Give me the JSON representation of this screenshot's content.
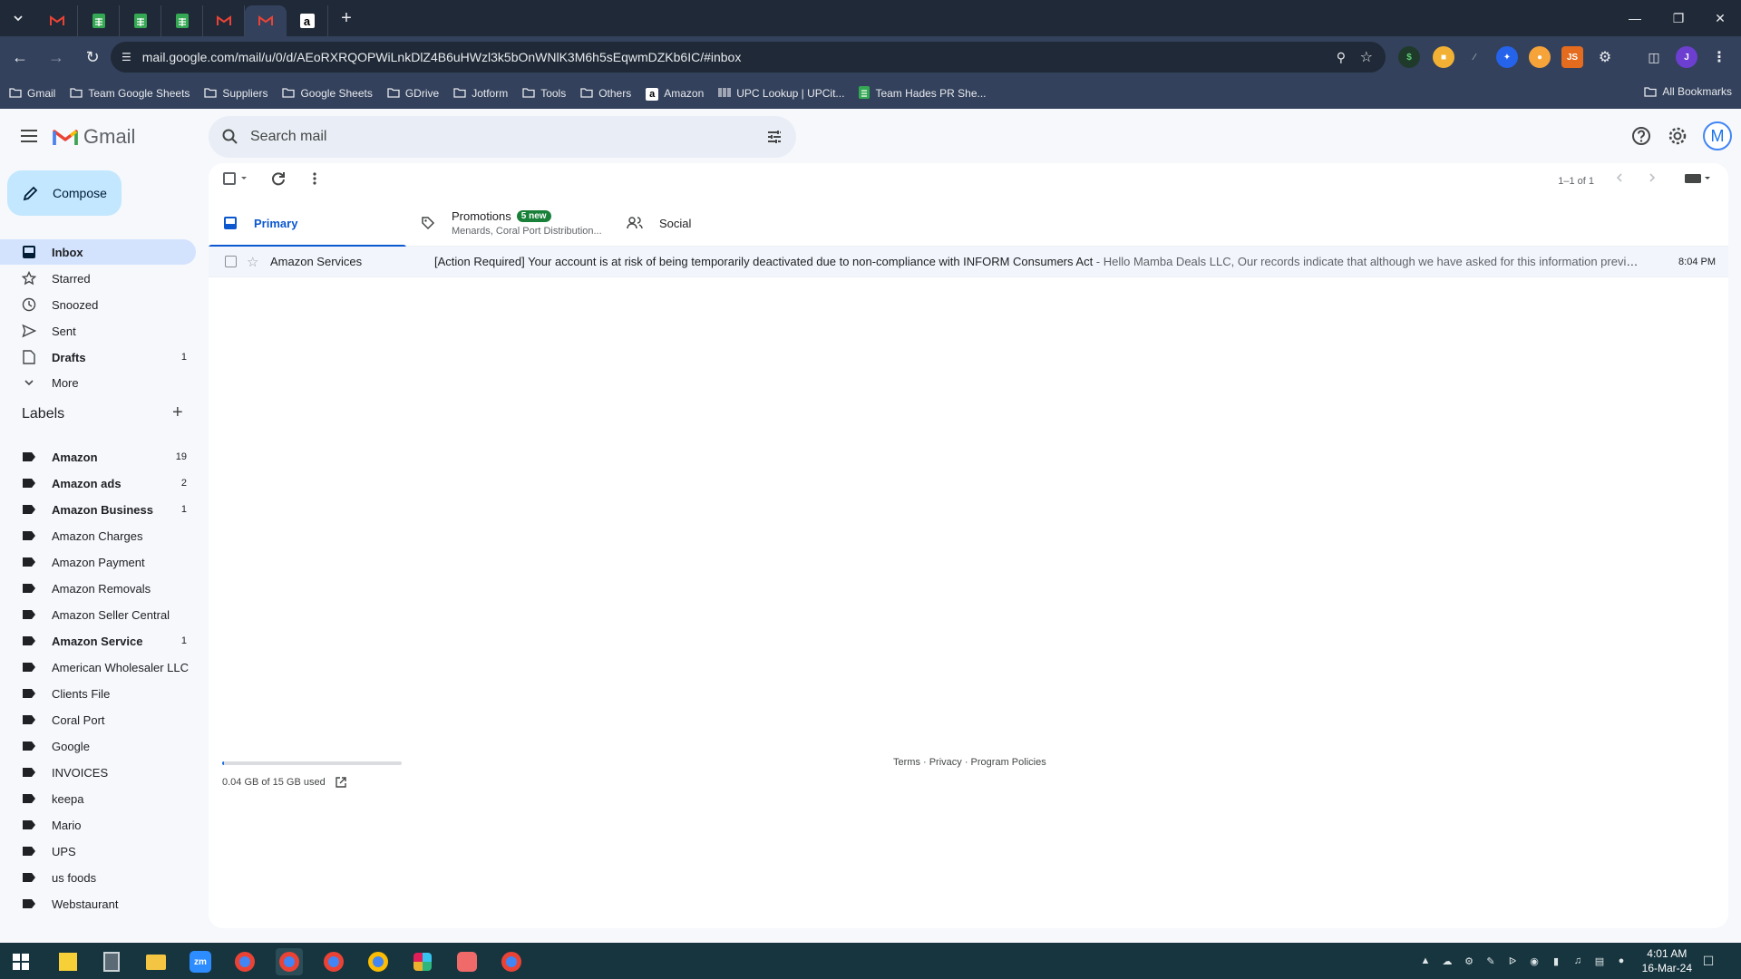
{
  "browser": {
    "address_url": "mail.google.com/mail/u/0/d/AEoRXRQOPWiLnkDlZ4B6uHWzl3k5bOnWNlK3M6h5sEqwmDZKb6IC/#inbox",
    "bookmarks": [
      {
        "label": "Gmail",
        "icon": "folder-icon"
      },
      {
        "label": "Team Google Sheets",
        "icon": "folder-icon"
      },
      {
        "label": "Suppliers",
        "icon": "folder-icon"
      },
      {
        "label": "Google Sheets",
        "icon": "folder-icon"
      },
      {
        "label": "GDrive",
        "icon": "folder-icon"
      },
      {
        "label": "Jotform",
        "icon": "folder-icon"
      },
      {
        "label": "Tools",
        "icon": "folder-icon"
      },
      {
        "label": "Others",
        "icon": "folder-icon"
      },
      {
        "label": "Amazon",
        "icon": "amazon-icon"
      },
      {
        "label": "UPC Lookup | UPCit...",
        "icon": "barcode-icon"
      },
      {
        "label": "Team Hades PR She...",
        "icon": "sheets-icon"
      }
    ],
    "all_bookmarks": "All Bookmarks"
  },
  "gmail": {
    "wordmark": "Gmail",
    "search_placeholder": "Search mail",
    "avatar_letter": "M",
    "compose_label": "Compose",
    "nav": [
      {
        "label": "Inbox",
        "icon": "inbox-icon",
        "count": ""
      },
      {
        "label": "Starred",
        "icon": "star-icon",
        "count": ""
      },
      {
        "label": "Snoozed",
        "icon": "clock-icon",
        "count": ""
      },
      {
        "label": "Sent",
        "icon": "send-icon",
        "count": ""
      },
      {
        "label": "Drafts",
        "icon": "draft-icon",
        "count": "1"
      },
      {
        "label": "More",
        "icon": "chevron-down-icon",
        "count": ""
      }
    ],
    "labels_heading": "Labels",
    "labels": [
      {
        "label": "Amazon",
        "count": "19",
        "bold": true
      },
      {
        "label": "Amazon ads",
        "count": "2",
        "bold": true
      },
      {
        "label": "Amazon Business",
        "count": "1",
        "bold": true
      },
      {
        "label": "Amazon Charges",
        "count": "",
        "bold": false
      },
      {
        "label": "Amazon Payment",
        "count": "",
        "bold": false
      },
      {
        "label": "Amazon Removals",
        "count": "",
        "bold": false
      },
      {
        "label": "Amazon Seller Central",
        "count": "",
        "bold": false
      },
      {
        "label": "Amazon Service",
        "count": "1",
        "bold": true
      },
      {
        "label": "American Wholesaler LLC",
        "count": "",
        "bold": false
      },
      {
        "label": "Clients File",
        "count": "",
        "bold": false
      },
      {
        "label": "Coral Port",
        "count": "",
        "bold": false
      },
      {
        "label": "Google",
        "count": "",
        "bold": false
      },
      {
        "label": "INVOICES",
        "count": "",
        "bold": false
      },
      {
        "label": "keepa",
        "count": "",
        "bold": false
      },
      {
        "label": "Mario",
        "count": "",
        "bold": false
      },
      {
        "label": "UPS",
        "count": "",
        "bold": false
      },
      {
        "label": "us foods",
        "count": "",
        "bold": false
      },
      {
        "label": "Webstaurant",
        "count": "",
        "bold": false
      }
    ],
    "page_count": "1–1 of 1",
    "tabs": {
      "primary": "Primary",
      "promotions": "Promotions",
      "promotions_badge": "5 new",
      "promotions_sub": "Menards, Coral Port Distribution...",
      "social": "Social"
    },
    "email": {
      "sender": "Amazon Services",
      "subject": "[Action Required] Your account is at risk of being temporarily deactivated due to non-compliance with INFORM Consumers Act",
      "snippet": " - Hello Mamba Deals LLC, Our records indicate that although we have asked for this information previously",
      "time": "8:04 PM"
    },
    "storage_text": "0.04 GB of 15 GB used",
    "storage_fraction": 0.003,
    "footer_links": "Terms · Privacy · Program Policies"
  },
  "taskbar": {
    "time": "4:01 AM",
    "date": "16-Mar-24"
  },
  "colors": {
    "accent": "#0b57d0",
    "compose_bg": "#c2e7ff",
    "active_nav": "#d3e3fd",
    "badge_green": "#188038",
    "chrome_dark": "#1f2937",
    "chrome_mid": "#33415c",
    "taskbar": "#17353f"
  }
}
